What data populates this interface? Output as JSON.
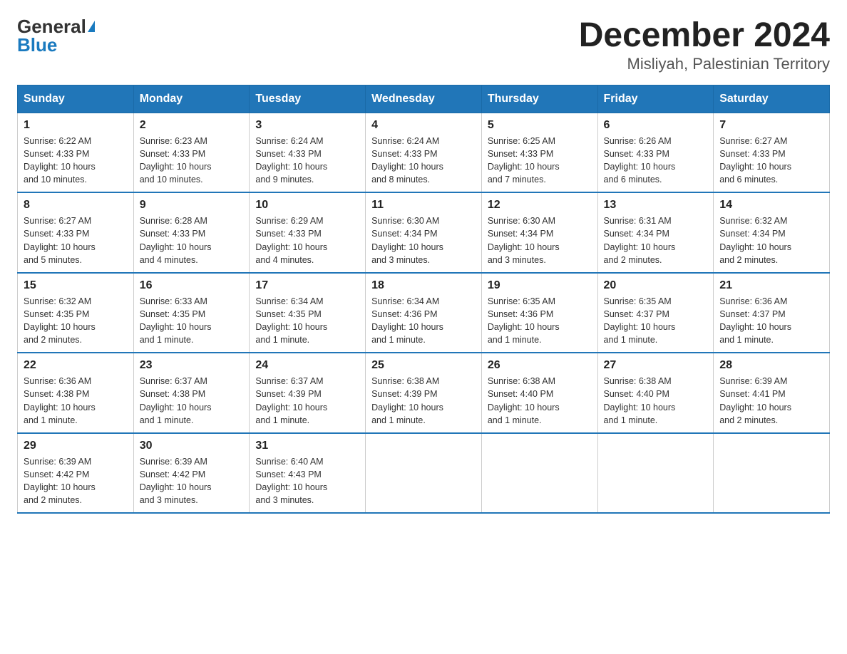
{
  "header": {
    "logo_general": "General",
    "logo_blue": "Blue",
    "month_title": "December 2024",
    "location": "Misliyah, Palestinian Territory"
  },
  "weekdays": [
    "Sunday",
    "Monday",
    "Tuesday",
    "Wednesday",
    "Thursday",
    "Friday",
    "Saturday"
  ],
  "weeks": [
    [
      {
        "day": "1",
        "sunrise": "6:22 AM",
        "sunset": "4:33 PM",
        "daylight": "10 hours and 10 minutes."
      },
      {
        "day": "2",
        "sunrise": "6:23 AM",
        "sunset": "4:33 PM",
        "daylight": "10 hours and 10 minutes."
      },
      {
        "day": "3",
        "sunrise": "6:24 AM",
        "sunset": "4:33 PM",
        "daylight": "10 hours and 9 minutes."
      },
      {
        "day": "4",
        "sunrise": "6:24 AM",
        "sunset": "4:33 PM",
        "daylight": "10 hours and 8 minutes."
      },
      {
        "day": "5",
        "sunrise": "6:25 AM",
        "sunset": "4:33 PM",
        "daylight": "10 hours and 7 minutes."
      },
      {
        "day": "6",
        "sunrise": "6:26 AM",
        "sunset": "4:33 PM",
        "daylight": "10 hours and 6 minutes."
      },
      {
        "day": "7",
        "sunrise": "6:27 AM",
        "sunset": "4:33 PM",
        "daylight": "10 hours and 6 minutes."
      }
    ],
    [
      {
        "day": "8",
        "sunrise": "6:27 AM",
        "sunset": "4:33 PM",
        "daylight": "10 hours and 5 minutes."
      },
      {
        "day": "9",
        "sunrise": "6:28 AM",
        "sunset": "4:33 PM",
        "daylight": "10 hours and 4 minutes."
      },
      {
        "day": "10",
        "sunrise": "6:29 AM",
        "sunset": "4:33 PM",
        "daylight": "10 hours and 4 minutes."
      },
      {
        "day": "11",
        "sunrise": "6:30 AM",
        "sunset": "4:34 PM",
        "daylight": "10 hours and 3 minutes."
      },
      {
        "day": "12",
        "sunrise": "6:30 AM",
        "sunset": "4:34 PM",
        "daylight": "10 hours and 3 minutes."
      },
      {
        "day": "13",
        "sunrise": "6:31 AM",
        "sunset": "4:34 PM",
        "daylight": "10 hours and 2 minutes."
      },
      {
        "day": "14",
        "sunrise": "6:32 AM",
        "sunset": "4:34 PM",
        "daylight": "10 hours and 2 minutes."
      }
    ],
    [
      {
        "day": "15",
        "sunrise": "6:32 AM",
        "sunset": "4:35 PM",
        "daylight": "10 hours and 2 minutes."
      },
      {
        "day": "16",
        "sunrise": "6:33 AM",
        "sunset": "4:35 PM",
        "daylight": "10 hours and 1 minute."
      },
      {
        "day": "17",
        "sunrise": "6:34 AM",
        "sunset": "4:35 PM",
        "daylight": "10 hours and 1 minute."
      },
      {
        "day": "18",
        "sunrise": "6:34 AM",
        "sunset": "4:36 PM",
        "daylight": "10 hours and 1 minute."
      },
      {
        "day": "19",
        "sunrise": "6:35 AM",
        "sunset": "4:36 PM",
        "daylight": "10 hours and 1 minute."
      },
      {
        "day": "20",
        "sunrise": "6:35 AM",
        "sunset": "4:37 PM",
        "daylight": "10 hours and 1 minute."
      },
      {
        "day": "21",
        "sunrise": "6:36 AM",
        "sunset": "4:37 PM",
        "daylight": "10 hours and 1 minute."
      }
    ],
    [
      {
        "day": "22",
        "sunrise": "6:36 AM",
        "sunset": "4:38 PM",
        "daylight": "10 hours and 1 minute."
      },
      {
        "day": "23",
        "sunrise": "6:37 AM",
        "sunset": "4:38 PM",
        "daylight": "10 hours and 1 minute."
      },
      {
        "day": "24",
        "sunrise": "6:37 AM",
        "sunset": "4:39 PM",
        "daylight": "10 hours and 1 minute."
      },
      {
        "day": "25",
        "sunrise": "6:38 AM",
        "sunset": "4:39 PM",
        "daylight": "10 hours and 1 minute."
      },
      {
        "day": "26",
        "sunrise": "6:38 AM",
        "sunset": "4:40 PM",
        "daylight": "10 hours and 1 minute."
      },
      {
        "day": "27",
        "sunrise": "6:38 AM",
        "sunset": "4:40 PM",
        "daylight": "10 hours and 1 minute."
      },
      {
        "day": "28",
        "sunrise": "6:39 AM",
        "sunset": "4:41 PM",
        "daylight": "10 hours and 2 minutes."
      }
    ],
    [
      {
        "day": "29",
        "sunrise": "6:39 AM",
        "sunset": "4:42 PM",
        "daylight": "10 hours and 2 minutes."
      },
      {
        "day": "30",
        "sunrise": "6:39 AM",
        "sunset": "4:42 PM",
        "daylight": "10 hours and 3 minutes."
      },
      {
        "day": "31",
        "sunrise": "6:40 AM",
        "sunset": "4:43 PM",
        "daylight": "10 hours and 3 minutes."
      },
      null,
      null,
      null,
      null
    ]
  ],
  "labels": {
    "sunrise": "Sunrise:",
    "sunset": "Sunset:",
    "daylight": "Daylight:"
  }
}
